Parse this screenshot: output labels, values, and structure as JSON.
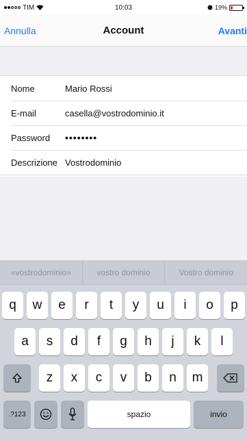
{
  "status_bar": {
    "carrier": "TIM",
    "time": "10:03",
    "battery_percent": "19%",
    "battery_level": 0.19
  },
  "nav": {
    "cancel_label": "Annulla",
    "title": "Account",
    "next_label": "Avanti"
  },
  "form": {
    "rows": [
      {
        "label": "Nome",
        "value": "Mario Rossi"
      },
      {
        "label": "E-mail",
        "value": "casella@vostrodominio.it"
      },
      {
        "label": "Password",
        "value": "••••••••"
      },
      {
        "label": "Descrizione",
        "value": "Vostrodominio"
      }
    ]
  },
  "keyboard": {
    "suggestions": [
      "«vostrodominio»",
      "vostro dominio",
      "Vostro dominio"
    ],
    "row1": [
      "q",
      "w",
      "e",
      "r",
      "t",
      "y",
      "u",
      "i",
      "o",
      "p"
    ],
    "row2": [
      "a",
      "s",
      "d",
      "f",
      "g",
      "h",
      "j",
      "k",
      "l"
    ],
    "row3": [
      "z",
      "x",
      "c",
      "v",
      "b",
      "n",
      "m"
    ],
    "numbers_label": ".?123",
    "space_label": "spazio",
    "return_label": "invio",
    "icons": {
      "shift": "shift-icon",
      "backspace": "backspace-icon",
      "emoji": "emoji-icon",
      "mic": "microphone-icon"
    }
  },
  "colors": {
    "accent": "#1a7cf4",
    "battery_low": "#e0302a",
    "keyboard_bg": "#d1d4da"
  }
}
